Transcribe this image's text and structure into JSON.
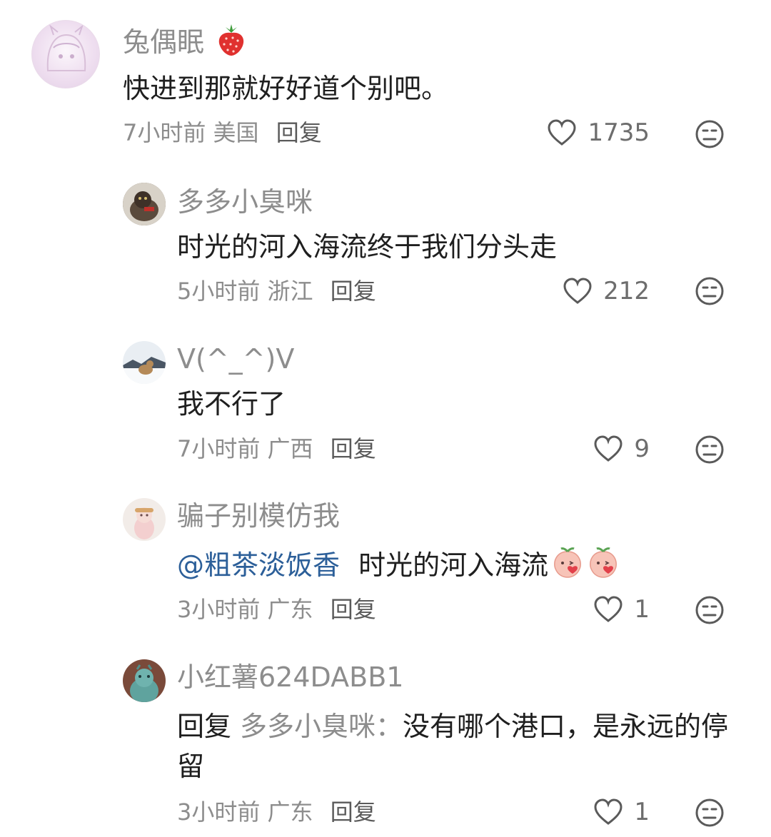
{
  "comments": [
    {
      "username": "兔偶眠",
      "username_emoji": "strawberry-emoji",
      "content": "快进到那就好好道个别吧。",
      "time": "7小时前",
      "location": "美国",
      "reply_label": "回复",
      "likes": "1735"
    },
    {
      "username": "多多小臭咪",
      "content": "时光的河入海流终于我们分头走",
      "time": "5小时前",
      "location": "浙江",
      "reply_label": "回复",
      "likes": "212"
    },
    {
      "username": "V(^_^)V",
      "content": "我不行了",
      "time": "7小时前",
      "location": "广西",
      "reply_label": "回复",
      "likes": "9"
    },
    {
      "username": "骗子别模仿我",
      "mention": "@粗茶淡饭香",
      "content": "时光的河入海流",
      "content_emoji": "peach-kiss-emoji",
      "time": "3小时前",
      "location": "广东",
      "reply_label": "回复",
      "likes": "1"
    },
    {
      "username": "小红薯624DABB1",
      "reply_prefix": "回复",
      "reply_target": "多多小臭咪：",
      "content": "没有哪个港口，是永远的停留",
      "time": "3小时前",
      "location": "广东",
      "reply_label": "回复",
      "likes": "1"
    }
  ],
  "colors": {
    "text": "#1f1f1f",
    "muted": "#8d8d8d",
    "mention": "#2c5f99",
    "background": "#ffffff"
  },
  "icons": {
    "like": "heart-outline-icon",
    "dislike": "neutral-face-icon"
  }
}
